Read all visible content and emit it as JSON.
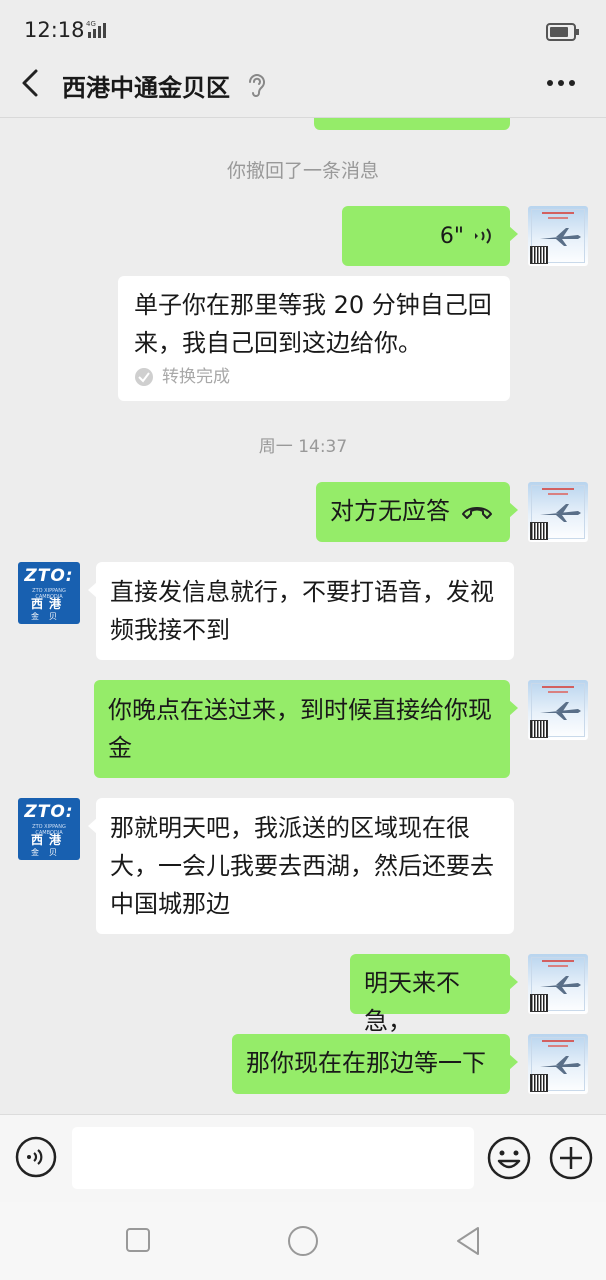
{
  "status_bar": {
    "time": "12:18",
    "network": "4G"
  },
  "header": {
    "title": "西港中通金贝区"
  },
  "messages": {
    "recall_notice": "你撤回了一条消息",
    "voice_duration": "6\"",
    "transcript_text": "单子你在那里等我 20 分钟自己回来，我自己回到这边给你。",
    "transcript_status": "转换完成",
    "timestamp": "周一 14:37",
    "call_status": "对方无应答",
    "other_1": "直接发信息就行，不要打语音，发视频我接不到",
    "self_1": "你晚点在送过来，到时候直接给你现金",
    "other_2": "那就明天吧，我派送的区域现在很大，一会儿我要去西湖，然后还要去中国城那边",
    "self_2": "明天来不急，",
    "self_3": "那你现在在那边等一下"
  },
  "avatar_other": {
    "logo": "ZTO:",
    "tagline": "ZTO XIPPANG CAMBODIA",
    "line1": "西港",
    "line2": "金贝"
  },
  "input": {
    "placeholder": ""
  },
  "colors": {
    "self_bubble": "#95ec69",
    "other_bubble": "#ffffff",
    "background": "#ededed"
  }
}
